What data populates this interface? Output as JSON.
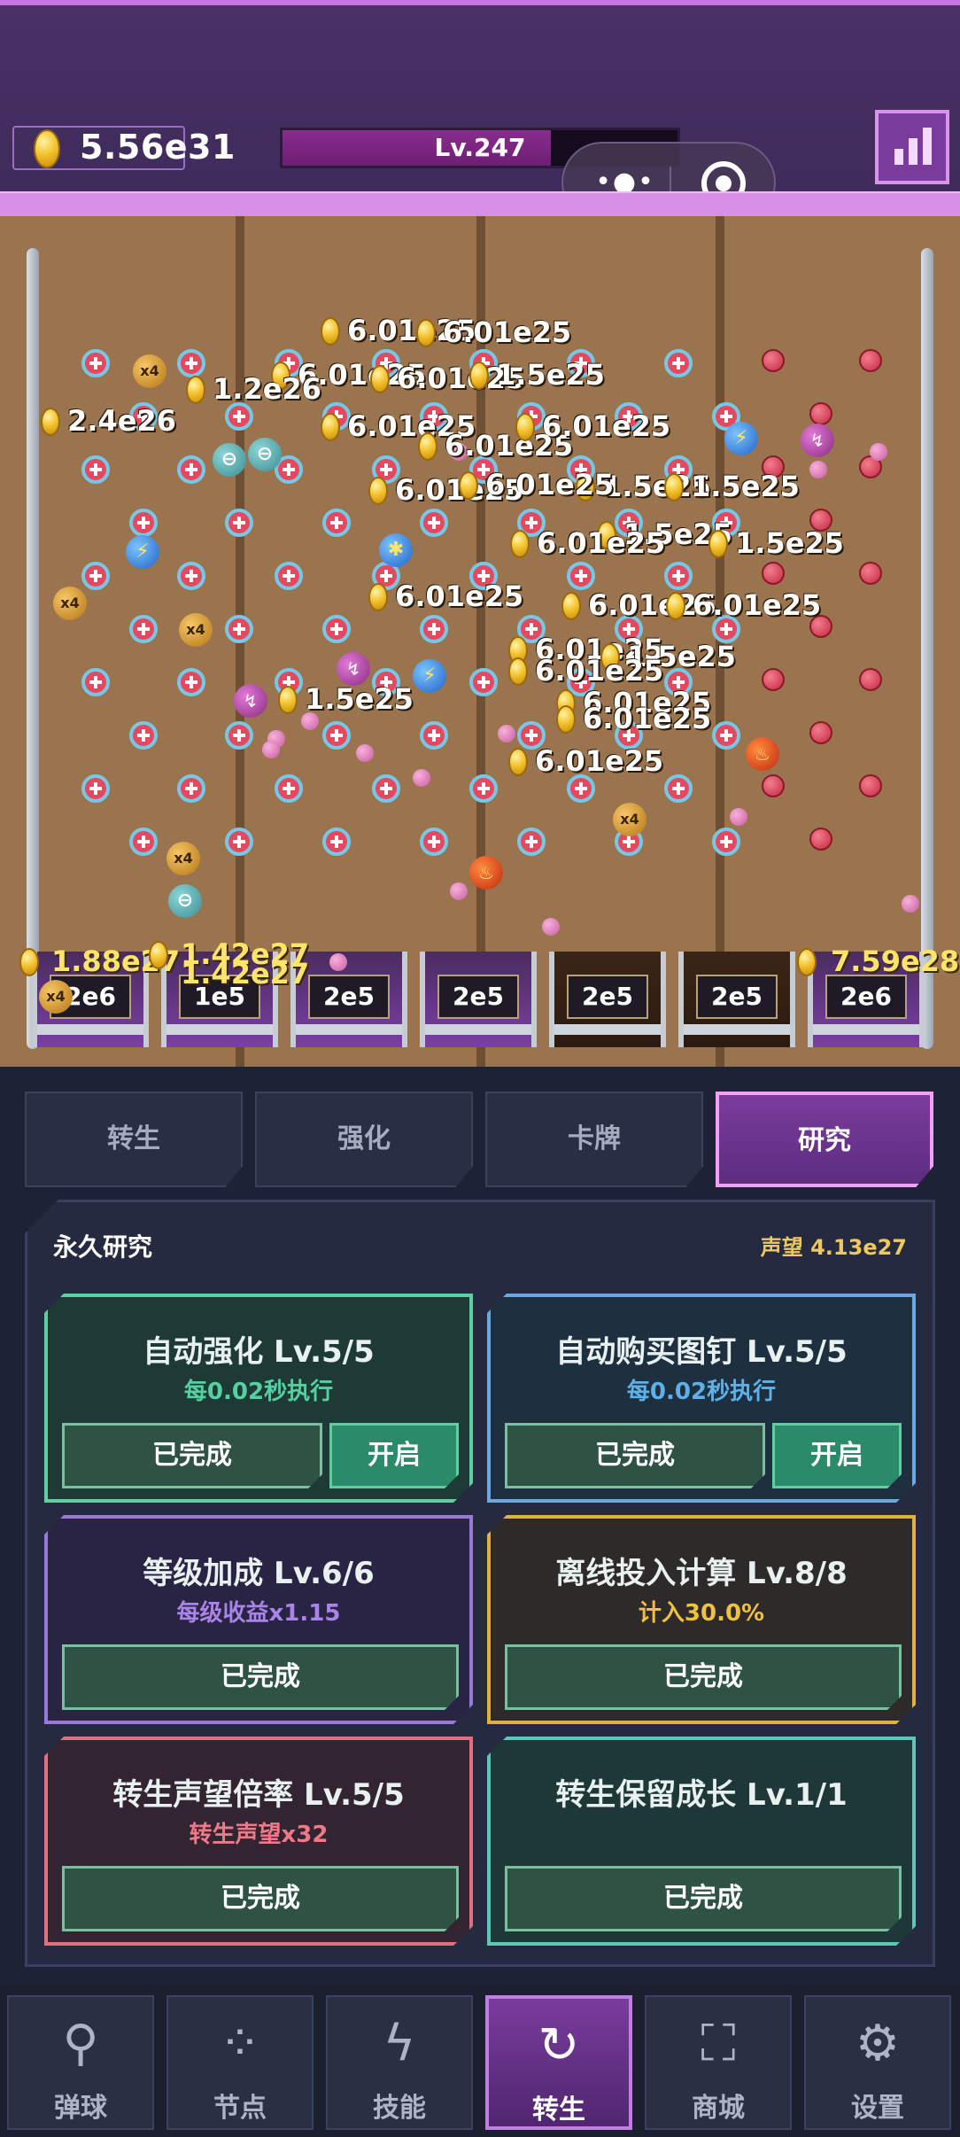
{
  "header": {
    "coins": "5.56e31",
    "level": "Lv.247",
    "level_progress": 0.68,
    "capsule_more": "•●•"
  },
  "board": {
    "left_slot_value": "1.88e27",
    "mid_slot_value_1": "1.42e27",
    "mid_slot_value_2": "1.42e27",
    "right_slot_value": "7.59e28",
    "bucket_labels": [
      "2e6",
      "1e5",
      "2e5",
      "2e5",
      "2e5",
      "2e5",
      "2e6"
    ],
    "floats": [
      "6.01e25",
      "6.01e25",
      "6.01e25",
      "6.01e25",
      "1.5e25",
      "6.01e25",
      "6.01e25",
      "6.01e25",
      "6.01e25",
      "1.5e25",
      "1.5e25",
      "6.01e25",
      "1.5e25",
      "6.01e25",
      "1.5e25",
      "6.01e25",
      "6.01e25",
      "6.01e25",
      "6.01e25",
      "1.5e25",
      "2.4e26",
      "1.2e26",
      "6.01e25",
      "1.5e25",
      "6.01e25",
      "6.01e25",
      "6.01e25"
    ],
    "x4_label": "x4"
  },
  "tabs": [
    "转生",
    "强化",
    "卡牌",
    "研究"
  ],
  "panel": {
    "title": "永久研究",
    "prestige": "声望 4.13e27",
    "cards": [
      {
        "title": "自动强化  Lv.5/5",
        "sub": "每0.02秒执行",
        "done": "已完成",
        "toggle": "开启",
        "color": "#5ed0a0",
        "sub_color": "#56d0a0",
        "bg": "#1e3a36"
      },
      {
        "title": "自动购买图钉  Lv.5/5",
        "sub": "每0.02秒执行",
        "done": "已完成",
        "toggle": "开启",
        "color": "#6aa8e0",
        "sub_color": "#5fb0e8",
        "bg": "#1e3040"
      },
      {
        "title": "等级加成  Lv.6/6",
        "sub": "每级收益x1.15",
        "done": "已完成",
        "color": "#9a78d8",
        "sub_color": "#a884e8",
        "bg": "#2a2444"
      },
      {
        "title": "离线投入计算  Lv.8/8",
        "sub": "计入30.0%",
        "done": "已完成",
        "color": "#e0b040",
        "sub_color": "#f0c040",
        "bg": "#2e2a2a"
      },
      {
        "title": "转生声望倍率  Lv.5/5",
        "sub": "转生声望x32",
        "done": "已完成",
        "color": "#e07080",
        "sub_color": "#f07888",
        "bg": "#322430"
      },
      {
        "title": "转生保留成长  Lv.1/1",
        "sub": "",
        "done": "已完成",
        "color": "#5ec8b8",
        "sub_color": "#5ec8b8",
        "bg": "#1e3838"
      }
    ]
  },
  "nav": [
    {
      "label": "弹球",
      "icon": "pinball-icon"
    },
    {
      "label": "节点",
      "icon": "nodes-icon"
    },
    {
      "label": "技能",
      "icon": "lightning-icon"
    },
    {
      "label": "转生",
      "icon": "rebirth-icon"
    },
    {
      "label": "商城",
      "icon": "shop-bag-icon"
    },
    {
      "label": "设置",
      "icon": "gear-icon"
    }
  ]
}
